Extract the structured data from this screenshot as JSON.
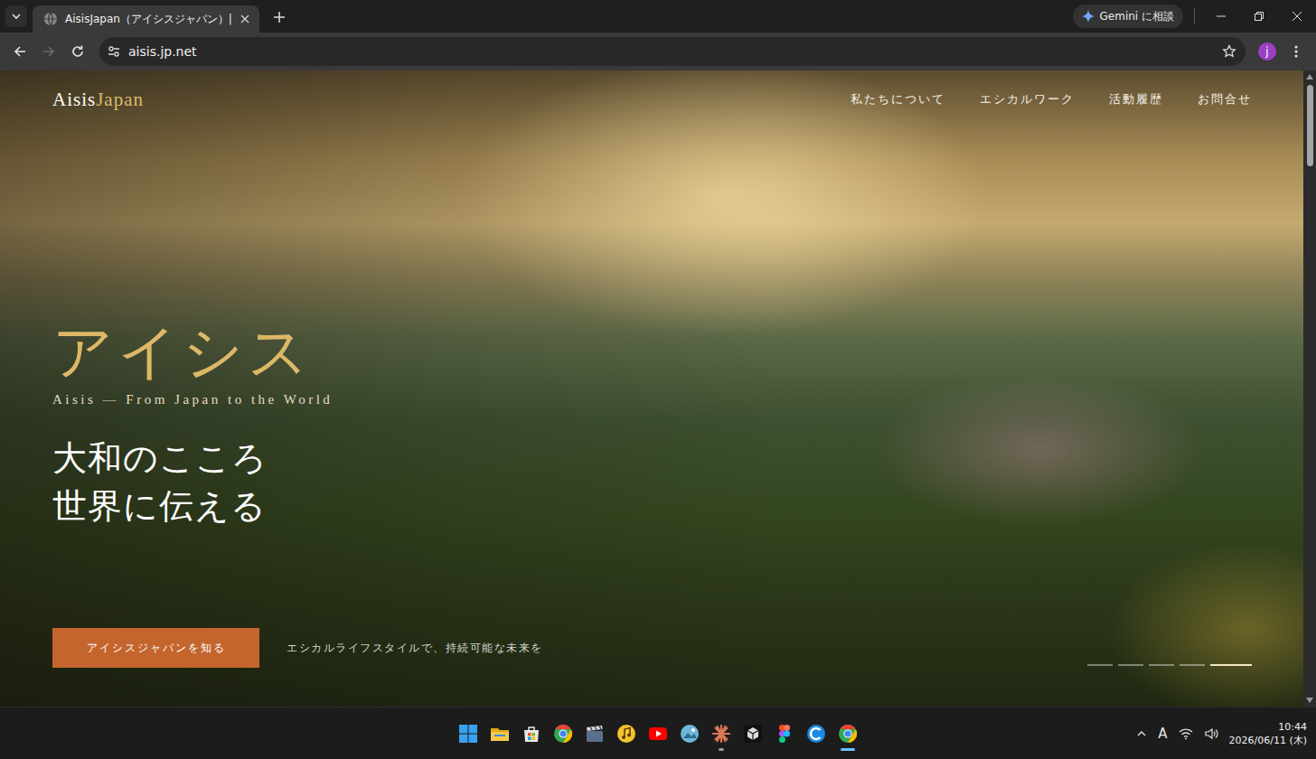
{
  "browser": {
    "tabs": [
      {
        "title": "AisisJapan（アイシスジャパン）|",
        "selected": true
      }
    ],
    "gemini_button": "Gemini に相談",
    "toolbar": {
      "back_enabled": true,
      "forward_enabled": false
    },
    "address": "aisis.jp.net",
    "profile": "j"
  },
  "site": {
    "logo": {
      "first": "Aisis",
      "second": "Japan"
    },
    "nav": [
      "私たちについて",
      "エシカルワーク",
      "活動履歴",
      "お問合せ"
    ],
    "hero": {
      "title": "アイシス",
      "subtitle": "Aisis — From Japan to the World",
      "tagline": [
        "大和のこころ",
        "世界に伝える"
      ],
      "cta": "アイシスジャパンを知る",
      "caption": "エシカルライフスタイルで、持続可能な未来を"
    },
    "slides": [
      {
        "selected": false
      },
      {
        "selected": false
      },
      {
        "selected": false
      },
      {
        "selected": false
      },
      {
        "selected": true
      }
    ]
  },
  "taskbar": {
    "apps": [
      {
        "kind": "start",
        "running": false,
        "active": false
      },
      {
        "kind": "explorer",
        "running": false,
        "active": false
      },
      {
        "kind": "store",
        "running": false,
        "active": false
      },
      {
        "kind": "chrome",
        "running": false,
        "active": false
      },
      {
        "kind": "clapper",
        "running": false,
        "active": false
      },
      {
        "kind": "music",
        "running": false,
        "active": false
      },
      {
        "kind": "youtube",
        "running": false,
        "active": false
      },
      {
        "kind": "photos",
        "running": false,
        "active": false
      },
      {
        "kind": "claude",
        "running": true,
        "active": false
      },
      {
        "kind": "cube",
        "running": false,
        "active": false
      },
      {
        "kind": "figma",
        "running": false,
        "active": false
      },
      {
        "kind": "cleaner",
        "running": false,
        "active": false
      },
      {
        "kind": "chrome",
        "running": true,
        "active": true
      }
    ],
    "tray": {
      "ime": "A"
    },
    "clock": {
      "time": "10:44",
      "date": "2026/06/11 (木)"
    }
  }
}
